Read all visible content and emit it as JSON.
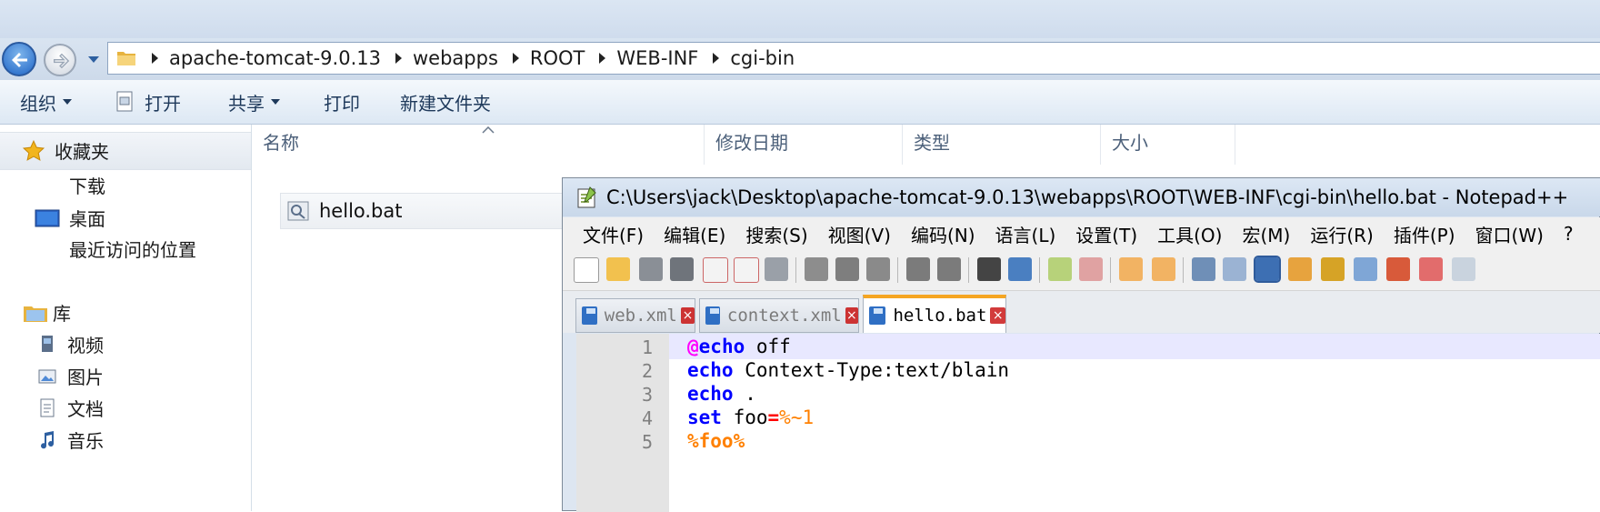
{
  "explorer": {
    "breadcrumb": [
      "apache-tomcat-9.0.13",
      "webapps",
      "ROOT",
      "WEB-INF",
      "cgi-bin"
    ],
    "commands": {
      "organize": "组织",
      "open": "打开",
      "share": "共享",
      "print": "打印",
      "new_folder": "新建文件夹"
    },
    "nav": {
      "favorites": "收藏夹",
      "downloads": "下载",
      "desktop": "桌面",
      "recent": "最近访问的位置",
      "libraries": "库",
      "videos": "视频",
      "pictures": "图片",
      "documents": "文档",
      "music": "音乐"
    },
    "columns": [
      "名称",
      "修改日期",
      "类型",
      "大小"
    ],
    "files": [
      {
        "name": "hello.bat",
        "icon": "batch-file-icon"
      }
    ]
  },
  "notepad": {
    "title": "C:\\Users\\jack\\Desktop\\apache-tomcat-9.0.13\\webapps\\ROOT\\WEB-INF\\cgi-bin\\hello.bat - Notepad++",
    "menu": [
      "文件(F)",
      "编辑(E)",
      "搜索(S)",
      "视图(V)",
      "编码(N)",
      "语言(L)",
      "设置(T)",
      "工具(O)",
      "宏(M)",
      "运行(R)",
      "插件(P)",
      "窗口(W)",
      "?"
    ],
    "tabs": [
      {
        "label": "web.xml",
        "active": false
      },
      {
        "label": "context.xml",
        "active": false
      },
      {
        "label": "hello.bat",
        "active": true
      }
    ],
    "line_numbers": [
      "1",
      "2",
      "3",
      "4",
      "5"
    ],
    "code": {
      "l1_at": "@",
      "l1_kw": "echo",
      "l1_rest": " off",
      "l2_kw": "echo",
      "l2_rest": " Context-Type:text/blain",
      "l3_kw": "echo",
      "l3_rest": " .",
      "l4_kw": "set",
      "l4_name": " foo",
      "l4_eq": "=",
      "l4_val": "%~1",
      "l5_var": "%foo%"
    },
    "colors": {
      "keyword": "#0000ff",
      "at_sign": "#ff00ff",
      "operator": "#ff0000",
      "variable": "#ff8000",
      "current_line": "#e8e8ff",
      "active_tab_accent": "#f5a623"
    }
  }
}
